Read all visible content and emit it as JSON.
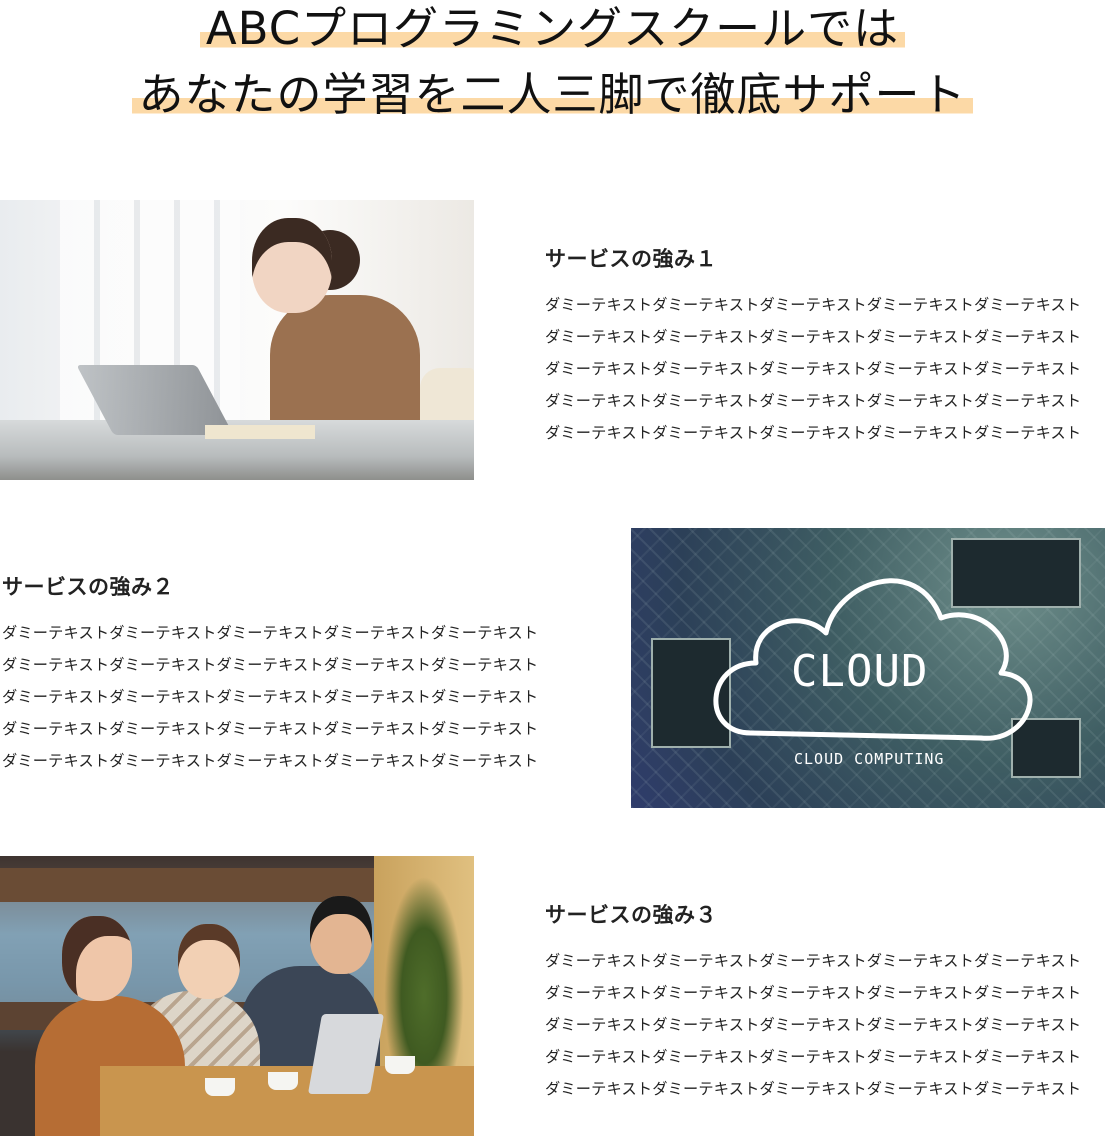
{
  "heading": {
    "line1": "ABCプログラミングスクールでは",
    "line2": "あなたの学習を二人三脚で徹底サポート",
    "highlight_color": "#fcd9a6"
  },
  "features": [
    {
      "title": "サービスの強み１",
      "body": [
        "ダミーテキストダミーテキストダミーテキストダミーテキストダミーテキスト",
        "ダミーテキストダミーテキストダミーテキストダミーテキストダミーテキスト",
        "ダミーテキストダミーテキストダミーテキストダミーテキストダミーテキスト",
        "ダミーテキストダミーテキストダミーテキストダミーテキストダミーテキスト",
        "ダミーテキストダミーテキストダミーテキストダミーテキストダミーテキスト"
      ],
      "image": "woman-working-on-laptop"
    },
    {
      "title": "サービスの強み２",
      "body": [
        "ダミーテキストダミーテキストダミーテキストダミーテキストダミーテキスト",
        "ダミーテキストダミーテキストダミーテキストダミーテキストダミーテキスト",
        "ダミーテキストダミーテキストダミーテキストダミーテキストダミーテキスト",
        "ダミーテキストダミーテキストダミーテキストダミーテキストダミーテキスト",
        "ダミーテキストダミーテキストダミーテキストダミーテキストダミーテキスト"
      ],
      "image": "cloud-computing-circuit-board",
      "image_text": {
        "main": "CLOUD",
        "sub": "CLOUD COMPUTING"
      }
    },
    {
      "title": "サービスの強み３",
      "body": [
        "ダミーテキストダミーテキストダミーテキストダミーテキストダミーテキスト",
        "ダミーテキストダミーテキストダミーテキストダミーテキストダミーテキスト",
        "ダミーテキストダミーテキストダミーテキストダミーテキストダミーテキスト",
        "ダミーテキストダミーテキストダミーテキストダミーテキストダミーテキスト",
        "ダミーテキストダミーテキストダミーテキストダミーテキストダミーテキスト"
      ],
      "image": "group-meeting-in-cafe"
    }
  ]
}
